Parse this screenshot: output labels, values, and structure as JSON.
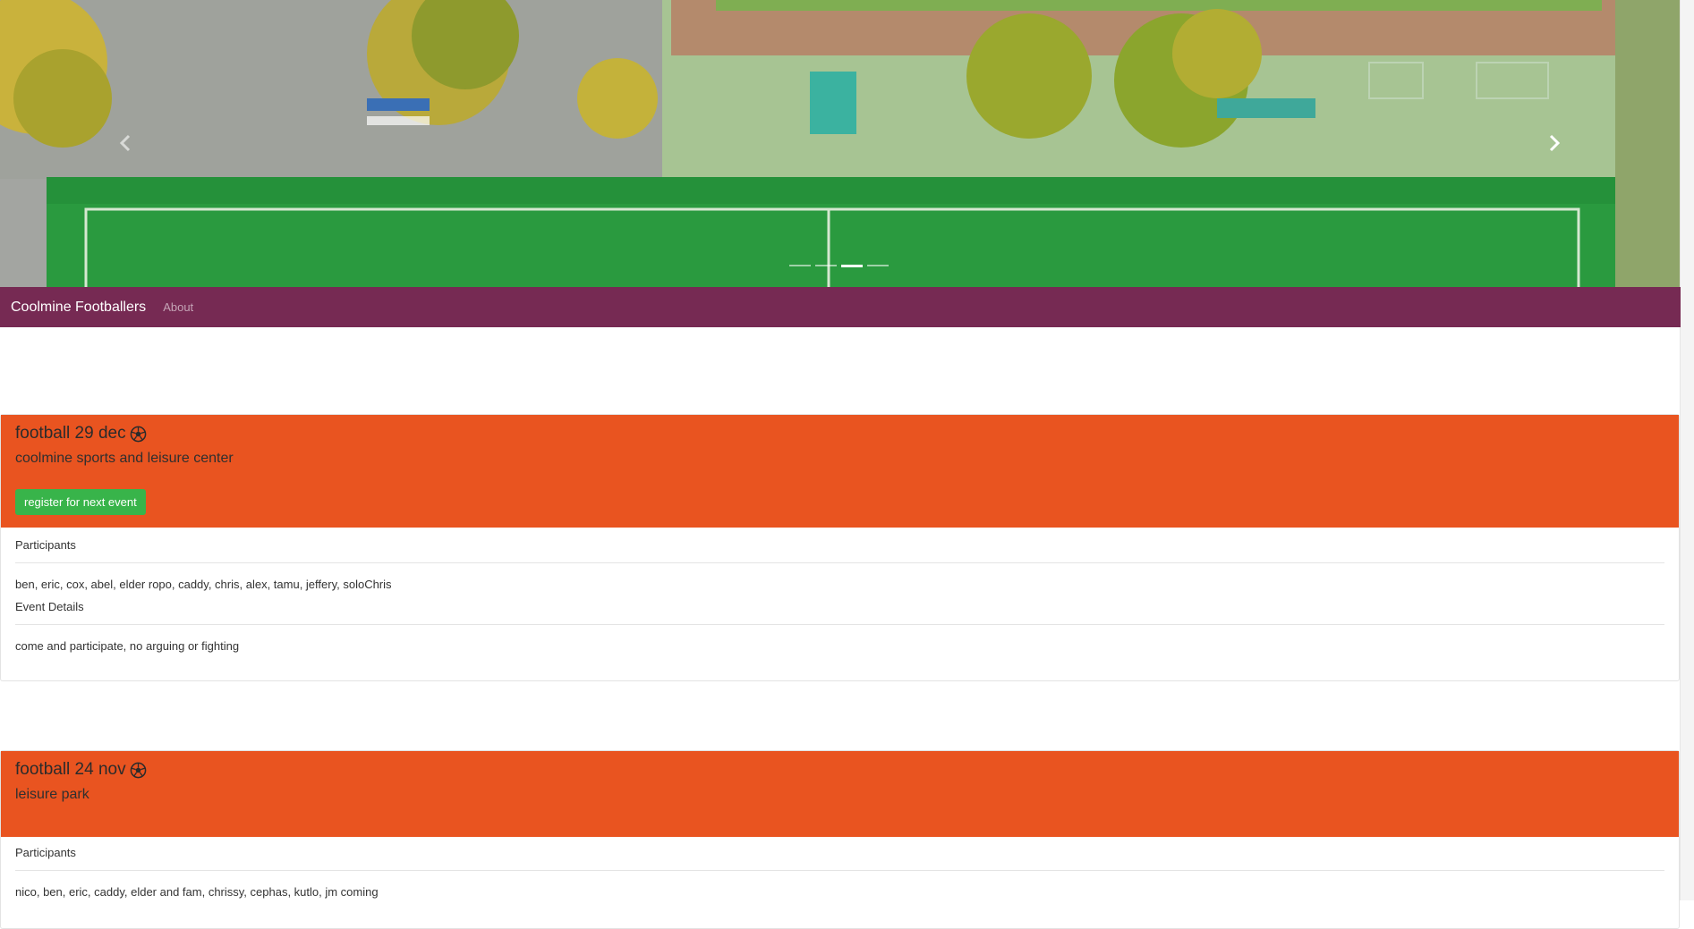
{
  "carousel": {
    "prev_icon": "chevron-left-icon",
    "next_icon": "chevron-right-icon",
    "slide_count": 4,
    "active_index": 2
  },
  "navbar": {
    "brand": "Coolmine Footballers",
    "links": [
      "About"
    ],
    "background": "#762a53"
  },
  "events": [
    {
      "title": "football 29 dec",
      "title_icon": "soccer-ball-icon",
      "location": "coolmine sports and leisure center",
      "register_label": "register for next event",
      "participants_label": "Participants",
      "participants": "ben, eric, cox, abel, elder ropo, caddy, chris, alex, tamu, jeffery, soloChris",
      "details_label": "Event Details",
      "details": "come and participate, no arguing or fighting"
    },
    {
      "title": "football 24 nov",
      "title_icon": "soccer-ball-icon",
      "location": "leisure park",
      "participants_label": "Participants",
      "participants": "nico, ben, eric, caddy, elder and fam, chrissy, cephas, kutlo, jm coming"
    }
  ],
  "colors": {
    "card_header": "#e95420",
    "register_button": "#38b44a"
  }
}
